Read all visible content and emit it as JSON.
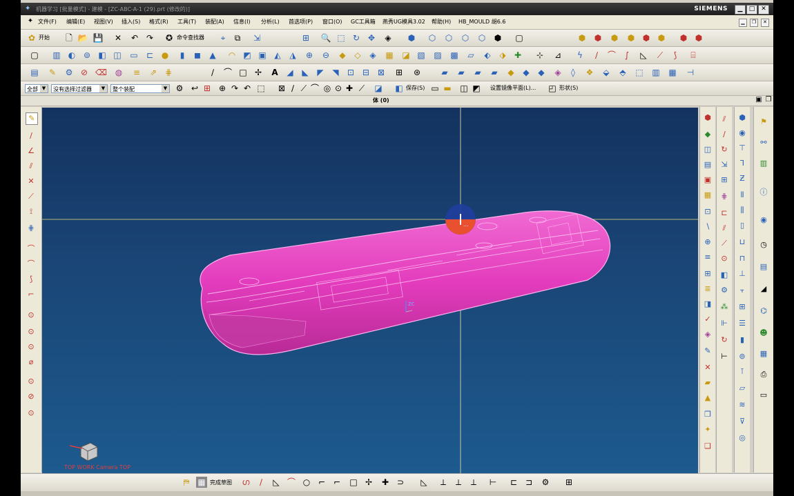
{
  "window": {
    "title": "机器学习 [批量模式] - 建模 - [ZC-ABC-A-1 (29).prt (修改的)]",
    "brand": "SIEMENS",
    "controls": {
      "minimize": "▁",
      "maximize": "□",
      "close": "✕"
    }
  },
  "menu": {
    "items": [
      "文件(F)",
      "编辑(E)",
      "视图(V)",
      "插入(S)",
      "格式(R)",
      "工具(T)",
      "装配(A)",
      "信息(I)",
      "分析(L)",
      "首选项(P)",
      "窗口(O)",
      "GC工具箱",
      "燕秀UG模具3.02",
      "帮助(H)",
      "HB_MOULD 胡6.6"
    ]
  },
  "toolbar": {
    "start_label": "开始",
    "command_finder_label": "命令查找器",
    "save_label": "保存(S)",
    "set_work_plane_label": "设置镜像平面(L)...",
    "shape_label": "形状(S)"
  },
  "selection": {
    "type_filter": "全部",
    "selection_filter": "没有选择过滤器",
    "scope": "整个装配"
  },
  "panel": {
    "title": "体 (0)"
  },
  "viewport": {
    "view_label": "TOP WORK Camera TOP",
    "axis_label": "ZC",
    "model_color": "#e83fc0",
    "bg_top": "#13325f",
    "bg_bottom": "#1d5a8e"
  },
  "bottombar": {
    "sketch_label": "完成草图"
  },
  "colors": {
    "accent": "#2a62b8",
    "model": "#e83fc0",
    "crosshair": "#c8c860"
  }
}
